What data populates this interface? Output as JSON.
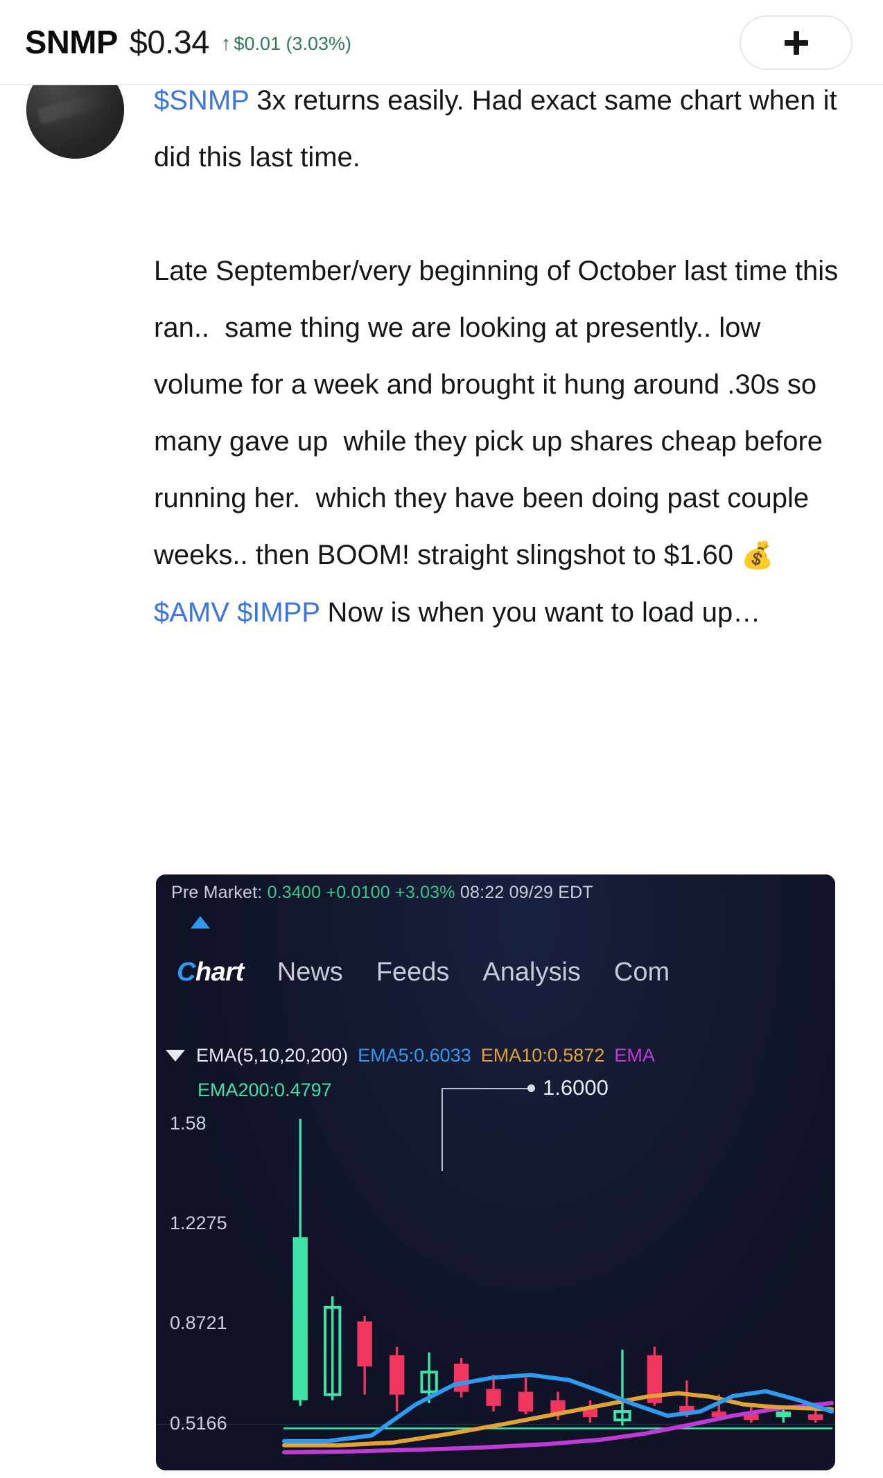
{
  "header": {
    "symbol": "SNMP",
    "price": "$0.34",
    "arrow_icon": "arrow-up-icon",
    "change": "$0.01 (3.03%)",
    "change_color": "#2e7d52",
    "add_button_label": "+"
  },
  "post": {
    "avatar_alt": "user-avatar",
    "segments": [
      {
        "type": "cashtag",
        "text": "$SNMP"
      },
      {
        "type": "text",
        "text": " 3x returns easily. Had exact same chart when it did this last time.\n\nLate September/very beginning of October last time this ran..  same thing we are looking at presently.. low volume for a week and brought it hung around .30s so many gave up  while they pick up shares cheap before running her.  which they have been doing past couple weeks.. then BOOM! straight slingshot to $1.60 "
      },
      {
        "type": "emoji",
        "text": "💰"
      },
      {
        "type": "text",
        "text": "\n"
      },
      {
        "type": "cashtag",
        "text": "$AMV"
      },
      {
        "type": "text",
        "text": " "
      },
      {
        "type": "cashtag",
        "text": "$IMPP"
      },
      {
        "type": "text",
        "text": " Now is when you want to load up…"
      }
    ]
  },
  "chart_card": {
    "premarket": {
      "label": "Pre Market:",
      "price": "0.3400",
      "change": "+0.0100",
      "change_pct": "+3.03%",
      "time": "08:22 09/29 EDT"
    },
    "tabs": [
      {
        "label": "Chart",
        "active": true,
        "initial": "C",
        "rest": "hart"
      },
      {
        "label": "News",
        "active": false
      },
      {
        "label": "Feeds",
        "active": false
      },
      {
        "label": "Analysis",
        "active": false
      },
      {
        "label": "Com",
        "active": false
      }
    ],
    "ema_legend": {
      "caret_icon": "chevron-down-icon",
      "title": "EMA(5,10,20,200)",
      "ema5": "EMA5:0.6033",
      "ema10": "EMA10:0.5872",
      "ema20": "EMA",
      "ema200": "EMA200:0.4797",
      "colors": {
        "ema5": "#2e9bf0",
        "ema10": "#e2a336",
        "ema20": "#c03ad6",
        "ema200": "#3fe3a8"
      }
    },
    "annotation": {
      "value": "1.6000"
    }
  },
  "chart_data": {
    "type": "candlestick",
    "title": "SNMP",
    "xlabel": "",
    "ylabel": "",
    "ylim": [
      0.4,
      1.73
    ],
    "grid": true,
    "y_ticks": [
      "1.58",
      "1.2275",
      "0.8721",
      "0.5166"
    ],
    "y_tick_values": [
      1.5829,
      1.2275,
      0.8721,
      0.5166
    ],
    "annotations": [
      {
        "text": "1.6000",
        "value": 1.6,
        "note": "peak wick high marker"
      }
    ],
    "up_color": "#3fe3a8",
    "down_color": "#f0355e",
    "candles": [
      {
        "o": 0.6,
        "h": 1.6,
        "l": 0.58,
        "c": 1.18,
        "dir": "up",
        "hollow": false
      },
      {
        "o": 0.93,
        "h": 0.97,
        "l": 0.6,
        "c": 0.62,
        "dir": "up",
        "hollow": true
      },
      {
        "o": 0.88,
        "h": 0.9,
        "l": 0.62,
        "c": 0.72,
        "dir": "down",
        "hollow": false
      },
      {
        "o": 0.76,
        "h": 0.79,
        "l": 0.56,
        "c": 0.62,
        "dir": "down",
        "hollow": false
      },
      {
        "o": 0.7,
        "h": 0.77,
        "l": 0.59,
        "c": 0.63,
        "dir": "up",
        "hollow": true
      },
      {
        "o": 0.73,
        "h": 0.75,
        "l": 0.61,
        "c": 0.63,
        "dir": "down",
        "hollow": false
      },
      {
        "o": 0.64,
        "h": 0.69,
        "l": 0.56,
        "c": 0.58,
        "dir": "down",
        "hollow": false
      },
      {
        "o": 0.63,
        "h": 0.68,
        "l": 0.55,
        "c": 0.56,
        "dir": "down",
        "hollow": false
      },
      {
        "o": 0.6,
        "h": 0.63,
        "l": 0.53,
        "c": 0.55,
        "dir": "down",
        "hollow": false
      },
      {
        "o": 0.57,
        "h": 0.6,
        "l": 0.52,
        "c": 0.54,
        "dir": "down",
        "hollow": false
      },
      {
        "o": 0.56,
        "h": 0.78,
        "l": 0.51,
        "c": 0.53,
        "dir": "up",
        "hollow": true
      },
      {
        "o": 0.76,
        "h": 0.79,
        "l": 0.58,
        "c": 0.59,
        "dir": "down",
        "hollow": false
      },
      {
        "o": 0.58,
        "h": 0.67,
        "l": 0.54,
        "c": 0.55,
        "dir": "down",
        "hollow": false
      },
      {
        "o": 0.56,
        "h": 0.62,
        "l": 0.53,
        "c": 0.54,
        "dir": "down",
        "hollow": false
      },
      {
        "o": 0.55,
        "h": 0.58,
        "l": 0.52,
        "c": 0.53,
        "dir": "down",
        "hollow": false
      },
      {
        "o": 0.54,
        "h": 0.58,
        "l": 0.52,
        "c": 0.56,
        "dir": "up",
        "hollow": false
      },
      {
        "o": 0.55,
        "h": 0.57,
        "l": 0.52,
        "c": 0.53,
        "dir": "down",
        "hollow": false
      }
    ],
    "series": [
      {
        "name": "EMA5",
        "color": "#2e9bf0",
        "last_value": 0.6033
      },
      {
        "name": "EMA10",
        "color": "#e2a336",
        "last_value": 0.5872
      },
      {
        "name": "EMA20",
        "color": "#c03ad6",
        "last_value": null
      },
      {
        "name": "EMA200",
        "color": "#3fe3a8",
        "last_value": 0.4797
      }
    ]
  }
}
